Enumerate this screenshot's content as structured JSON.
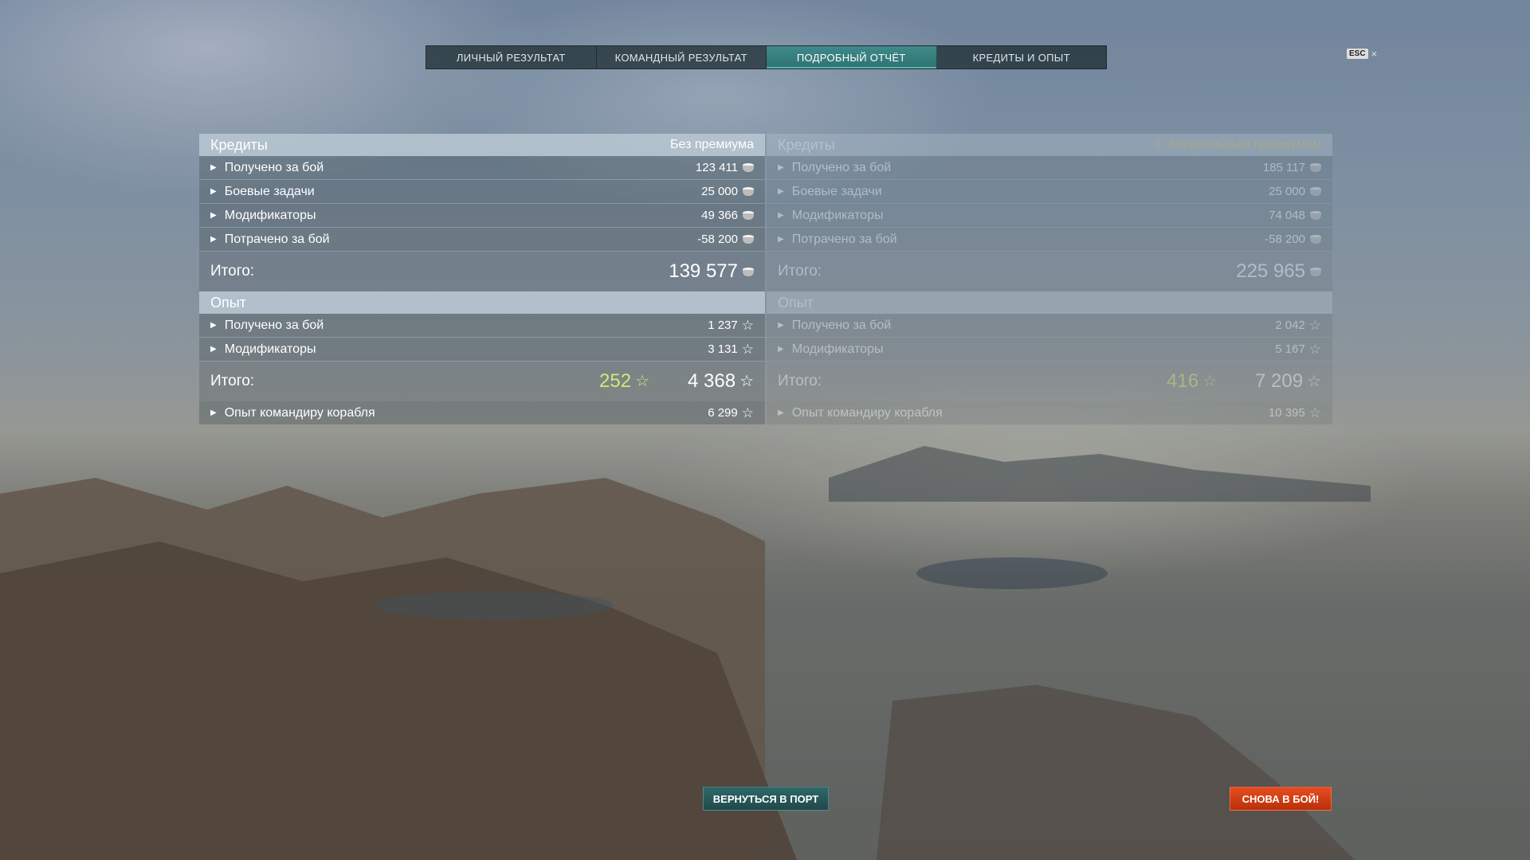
{
  "tabs": [
    "ЛИЧНЫЙ РЕЗУЛЬТАТ",
    "КОМАНДНЫЙ РЕЗУЛЬТАТ",
    "ПОДРОБНЫЙ ОТЧЁТ",
    "КРЕДИТЫ И ОПЫТ"
  ],
  "active_tab": "ПОДРОБНЫЙ ОТЧЁТ",
  "esc": {
    "key": "ESC",
    "close": "×"
  },
  "left": {
    "credits": {
      "title": "Кредиты",
      "subtitle": "Без премиума",
      "rows": [
        {
          "label": "Получено за бой",
          "value": "123 411"
        },
        {
          "label": "Боевые задачи",
          "value": "25 000"
        },
        {
          "label": "Модификаторы",
          "value": "49 366"
        },
        {
          "label": "Потрачено за бой",
          "value": "-58 200"
        }
      ],
      "total_label": "Итого:",
      "total": "139 577"
    },
    "xp": {
      "title": "Опыт",
      "rows": [
        {
          "label": "Получено за бой",
          "value": "1 237"
        },
        {
          "label": "Модификаторы",
          "value": "3 131"
        }
      ],
      "total_label": "Итого:",
      "free_xp": "252",
      "total": "4 368"
    },
    "commander": {
      "label": "Опыт командиру корабля",
      "value": "6 299"
    }
  },
  "right": {
    "credits": {
      "title": "Кредиты",
      "subtitle": "С Корабельным премиумом",
      "rows": [
        {
          "label": "Получено за бой",
          "value": "185 117"
        },
        {
          "label": "Боевые задачи",
          "value": "25 000"
        },
        {
          "label": "Модификаторы",
          "value": "74 048"
        },
        {
          "label": "Потрачено за бой",
          "value": "-58 200"
        }
      ],
      "total_label": "Итого:",
      "total": "225 965"
    },
    "xp": {
      "title": "Опыт",
      "rows": [
        {
          "label": "Получено за бой",
          "value": "2 042"
        },
        {
          "label": "Модификаторы",
          "value": "5 167"
        }
      ],
      "total_label": "Итого:",
      "free_xp": "416",
      "total": "7 209"
    },
    "commander": {
      "label": "Опыт командиру корабля",
      "value": "10 395"
    }
  },
  "buttons": {
    "port": "ВЕРНУТЬСЯ В ПОРТ",
    "battle": "СНОВА В БОЙ!"
  },
  "colors": {
    "active_tab": "#2f7272",
    "premium_text": "#f1d265",
    "free_xp": "#c9ec75",
    "battle_button": "#d8401a",
    "port_button": "#2a5e5f"
  }
}
